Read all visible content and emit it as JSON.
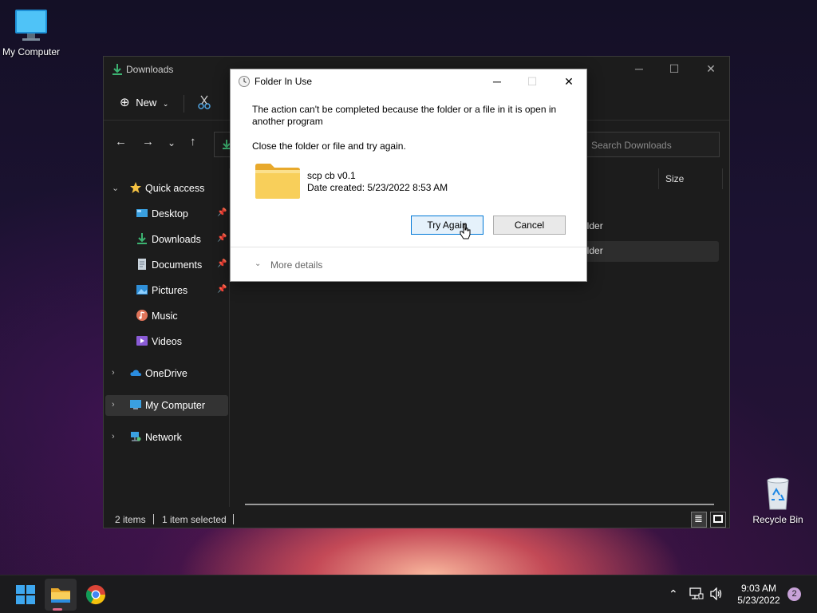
{
  "desktop": {
    "icons": [
      {
        "label": "My Computer",
        "icon": "monitor-icon"
      },
      {
        "label": "Recycle Bin",
        "icon": "recycle-bin-icon"
      }
    ]
  },
  "explorer": {
    "title": "Downloads",
    "toolbar": {
      "new_label": "New"
    },
    "search_placeholder": "Search Downloads",
    "sidebar": [
      {
        "label": "Quick access",
        "icon": "star-icon",
        "expanded": true
      },
      {
        "label": "Desktop",
        "icon": "desktop-folder-icon",
        "pinned": true
      },
      {
        "label": "Downloads",
        "icon": "download-icon",
        "pinned": true
      },
      {
        "label": "Documents",
        "icon": "documents-icon",
        "pinned": true
      },
      {
        "label": "Pictures",
        "icon": "pictures-icon",
        "pinned": true
      },
      {
        "label": "Music",
        "icon": "music-icon"
      },
      {
        "label": "Videos",
        "icon": "videos-icon"
      },
      {
        "label": "OneDrive",
        "icon": "cloud-icon"
      },
      {
        "label": "My Computer",
        "icon": "computer-icon",
        "selected": true
      },
      {
        "label": "Network",
        "icon": "network-icon"
      }
    ],
    "columns": {
      "size": "Size"
    },
    "rows": [
      {
        "type": "older"
      },
      {
        "type": "older"
      }
    ],
    "status": {
      "items": "2 items",
      "selected": "1 item selected"
    }
  },
  "dialog": {
    "title": "Folder In Use",
    "message": "The action can't be completed because the folder or a file in it is open in another program",
    "instruction": "Close the folder or file and try again.",
    "item_name": "scp cb v0.1",
    "item_date": "Date created: 5/23/2022 8:53 AM",
    "try_again_label": "Try Again",
    "cancel_label": "Cancel",
    "more_details_label": "More details"
  },
  "taskbar": {
    "time": "9:03 AM",
    "date": "5/23/2022",
    "notification_count": "2"
  },
  "colors": {
    "accent": "#0078d7",
    "folder": "#f5c74a",
    "download_green": "#3cb371"
  }
}
